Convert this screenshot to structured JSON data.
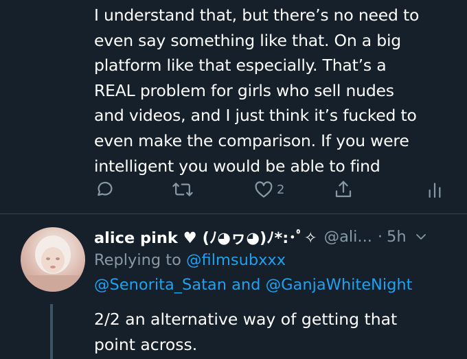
{
  "tweet": {
    "lines": [
      "I understand that, but there’s no need to",
      "even say something like that. On a big",
      "platform like that especially. That’s a",
      "REAL problem for girls who sell nudes",
      "and videos, and I just think it’s fucked to",
      "even make the comparison. If you were",
      "intelligent you would be able to find"
    ],
    "actions": {
      "reply_icon": "reply-icon",
      "retweet_icon": "retweet-icon",
      "like_icon": "heart-icon",
      "like_count": "2",
      "share_icon": "share-icon",
      "analytics_icon": "analytics-icon"
    }
  },
  "reply": {
    "display_name": "alice pink ♥ (ﾉ◕ヮ◕)ﾉ*:･ﾟ✧",
    "handle": "@ali...",
    "separator": "·",
    "time": "5h",
    "replying_to_label": "Replying to",
    "mentions": [
      "@filmsubxxx",
      "@Senorita_Satan",
      "@GanjaWhiteNight"
    ],
    "and_label": "and",
    "body_lines": [
      "2/2 an alternative way of getting that",
      "point across."
    ]
  },
  "colors": {
    "background": "#15202b",
    "text": "#ffffff",
    "muted": "#8899a6",
    "link": "#1da1f2",
    "divider": "#38444d"
  }
}
